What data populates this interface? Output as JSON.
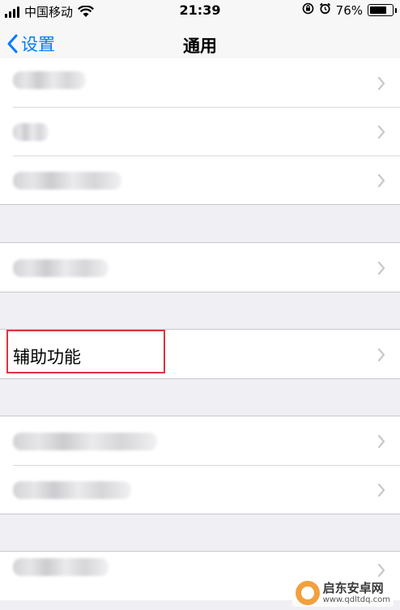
{
  "status_bar": {
    "carrier": "中国移动",
    "time": "21:39",
    "battery_percent": "76%",
    "battery_level": 0.76
  },
  "nav": {
    "back_label": "设置",
    "title": "通用"
  },
  "groups": [
    {
      "rows": [
        {
          "label": "",
          "blurred": true
        },
        {
          "label": "",
          "blurred": true
        },
        {
          "label": "",
          "blurred": true
        }
      ]
    },
    {
      "rows": [
        {
          "label": "",
          "blurred": true
        }
      ]
    },
    {
      "rows": [
        {
          "label": "辅助功能",
          "blurred": false,
          "highlighted": true
        }
      ]
    },
    {
      "rows": [
        {
          "label": "",
          "blurred": true
        },
        {
          "label": "",
          "blurred": true
        }
      ]
    },
    {
      "rows": [
        {
          "label": "",
          "blurred": true
        }
      ]
    }
  ],
  "watermark": {
    "name": "启东安卓网",
    "url": "www.qdltdq.com"
  },
  "colors": {
    "accent": "#007aff",
    "highlight": "#d9363e",
    "background": "#efeff4"
  }
}
